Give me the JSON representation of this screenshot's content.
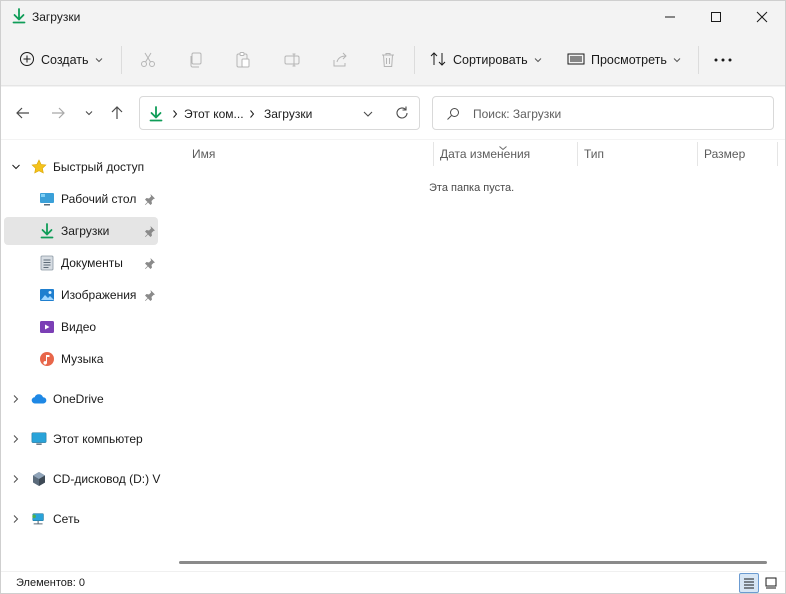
{
  "window": {
    "title": "Загрузки",
    "accent": "#0f9d58"
  },
  "toolbar": {
    "create_label": "Создать",
    "sort_label": "Сортировать",
    "view_label": "Просмотреть",
    "icons": [
      "cut-icon",
      "copy-icon",
      "paste-icon",
      "rename-icon",
      "share-icon",
      "delete-icon"
    ]
  },
  "nav": {
    "breadcrumb": [
      "Этот ком...",
      "Загрузки"
    ],
    "search_placeholder": "Поиск: Загрузки"
  },
  "sidebar": {
    "quick_access": "Быстрый доступ",
    "items": [
      {
        "label": "Рабочий стол",
        "pinned": true
      },
      {
        "label": "Загрузки",
        "pinned": true,
        "selected": true
      },
      {
        "label": "Документы",
        "pinned": true
      },
      {
        "label": "Изображения",
        "pinned": true
      },
      {
        "label": "Видео",
        "pinned": false
      },
      {
        "label": "Музыка",
        "pinned": false
      }
    ],
    "roots": [
      "OneDrive",
      "Этот компьютер",
      "CD-дисковод (D:) V",
      "Сеть"
    ]
  },
  "content": {
    "columns": [
      "Имя",
      "Дата изменения",
      "Тип",
      "Размер"
    ],
    "empty_text": "Эта папка пуста."
  },
  "status": {
    "items_text": "Элементов: 0"
  }
}
